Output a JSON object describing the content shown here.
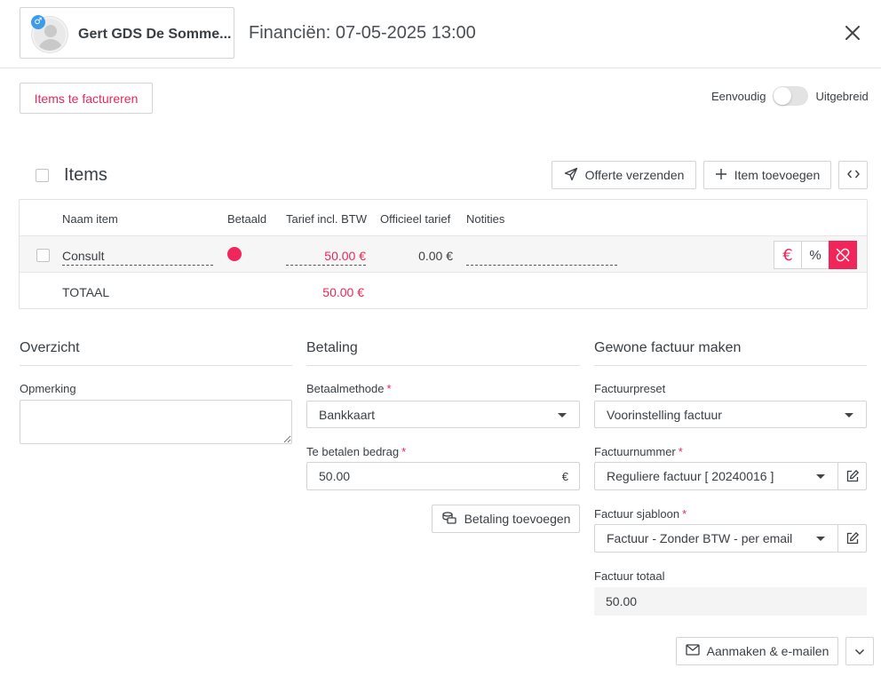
{
  "header": {
    "patient_name": "Gert GDS De Somme...",
    "gender_symbol": "♂",
    "title": "Financiën: 07-05-2025 13:00"
  },
  "toolbar": {
    "items_to_invoice_label": "Items te factureren",
    "mode_simple_label": "Eenvoudig",
    "mode_extended_label": "Uitgebreid",
    "mode_extended_on": false
  },
  "items": {
    "title": "Items",
    "send_quote_label": "Offerte verzenden",
    "add_item_label": "Item toevoegen",
    "columns": [
      "Naam item",
      "Betaald",
      "Tarief incl. BTW",
      "Officieel tarief",
      "Notities"
    ],
    "rows": [
      {
        "name": "Consult",
        "paid": false,
        "rate": "50.00 €",
        "official_rate": "0.00 €",
        "notes": ""
      }
    ],
    "total_label": "TOTAAL",
    "total_value": "50.00 €"
  },
  "overview": {
    "title": "Overzicht",
    "remark_label": "Opmerking",
    "remark_value": ""
  },
  "payment": {
    "title": "Betaling",
    "method_label": "Betaalmethode",
    "method_value": "Bankkaart",
    "amount_label": "Te betalen bedrag",
    "amount_value": "50.00",
    "currency_symbol": "€",
    "add_payment_label": "Betaling toevoegen"
  },
  "invoice": {
    "title": "Gewone factuur maken",
    "preset_label": "Factuurpreset",
    "preset_value": "Voorinstelling factuur",
    "number_label": "Factuurnummer",
    "number_value": "Reguliere factuur [ 20240016 ]",
    "template_label": "Factuur sjabloon",
    "template_value": "Factuur - Zonder BTW - per email",
    "total_label": "Factuur totaal",
    "total_value": "50.00",
    "create_email_label": "Aanmaken & e-mailen"
  },
  "colors": {
    "accent": "#e8285a",
    "paid_dot": "#f0265b",
    "gender_badge": "#3d9be9"
  }
}
